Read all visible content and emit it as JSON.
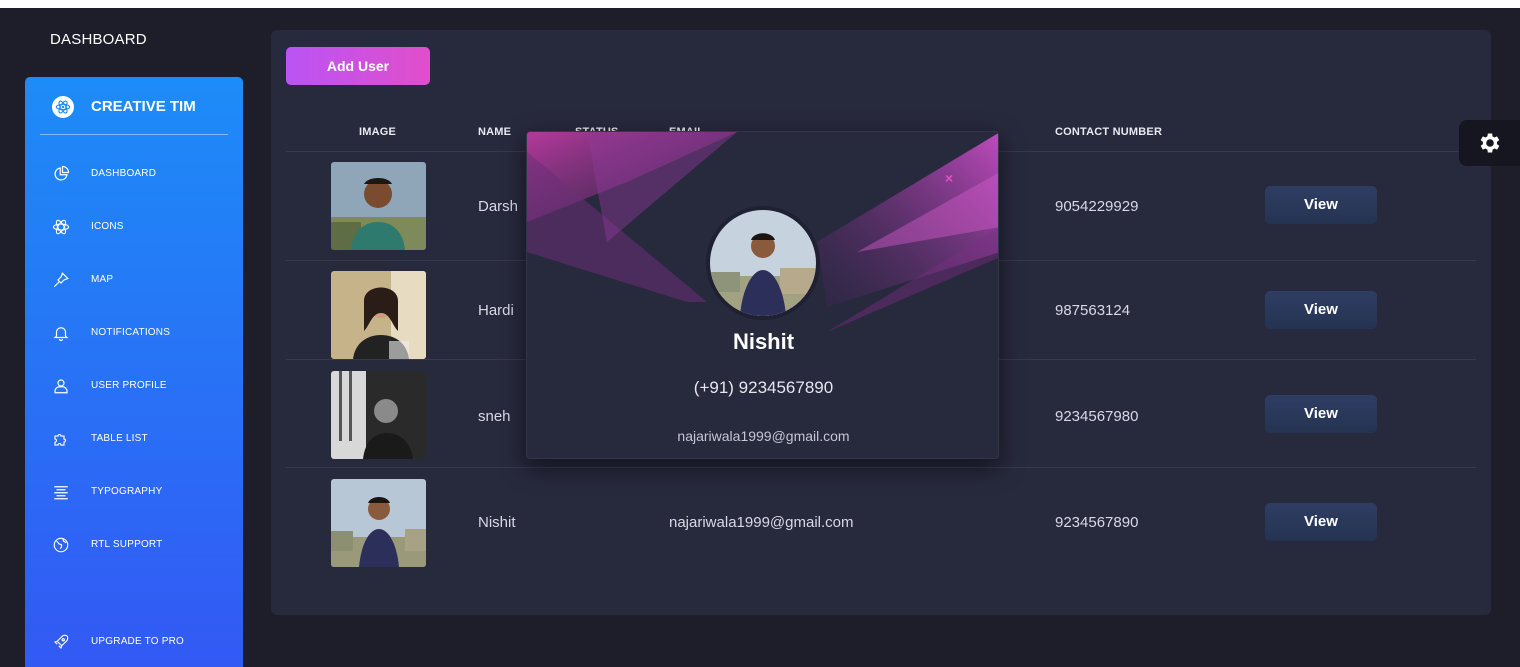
{
  "header": {
    "title": "DASHBOARD"
  },
  "sidebar": {
    "brand": "CREATIVE TIM",
    "items": [
      {
        "label": "DASHBOARD",
        "icon": "pie-chart-icon"
      },
      {
        "label": "ICONS",
        "icon": "atom-icon"
      },
      {
        "label": "MAP",
        "icon": "pin-icon"
      },
      {
        "label": "NOTIFICATIONS",
        "icon": "bell-icon"
      },
      {
        "label": "USER PROFILE",
        "icon": "user-icon"
      },
      {
        "label": "TABLE LIST",
        "icon": "puzzle-icon"
      },
      {
        "label": "TYPOGRAPHY",
        "icon": "align-center-icon"
      },
      {
        "label": "RTL SUPPORT",
        "icon": "globe-icon"
      }
    ],
    "upgrade": {
      "label": "UPGRADE TO PRO",
      "icon": "spaceship-icon"
    }
  },
  "toolbar": {
    "add_user_label": "Add User"
  },
  "table": {
    "columns": [
      "IMAGE",
      "NAME",
      "STATUS",
      "EMAIL",
      "CONTACT NUMBER"
    ],
    "rows": [
      {
        "name": "Darsh",
        "email": "",
        "contact": "9054229929",
        "action": "View"
      },
      {
        "name": "Hardi",
        "email": "",
        "contact": "987563124",
        "action": "View"
      },
      {
        "name": "sneh",
        "email": "",
        "contact": "9234567980",
        "action": "View"
      },
      {
        "name": "Nishit",
        "email": "najariwala1999@gmail.com",
        "contact": "9234567890",
        "action": "View"
      }
    ]
  },
  "modal": {
    "close_label": "×",
    "name": "Nishit",
    "phone": "(+91) 9234567890",
    "email": "najariwala1999@gmail.com"
  },
  "colors": {
    "sidebar_top": "#1d8cf8",
    "sidebar_bottom": "#3358f4",
    "card_bg": "#27293d",
    "page_bg": "#1e1e2a",
    "accent_pink": "#e14eca",
    "accent_purple": "#ba54f5"
  }
}
